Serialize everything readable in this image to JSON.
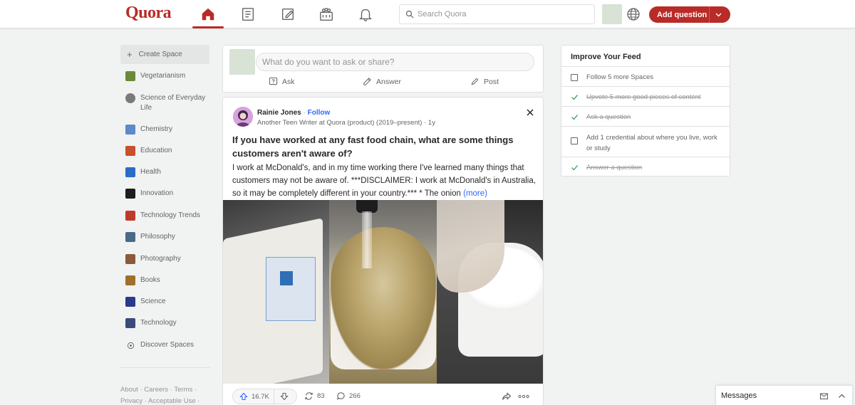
{
  "header": {
    "logo": "Quora",
    "search_placeholder": "Search Quora",
    "add_question_label": "Add question",
    "nav_icons": [
      "home-icon",
      "following-icon",
      "answer-icon",
      "spaces-icon",
      "notifications-icon"
    ],
    "brand_color": "#b92b27"
  },
  "sidebar": {
    "create_space": "Create Space",
    "items": [
      {
        "label": "Vegetarianism",
        "color": "#6a8a3a"
      },
      {
        "label": "Science of Everyday Life",
        "color": "#7a7a7a"
      },
      {
        "label": "Chemistry",
        "color": "#5b8bc9"
      },
      {
        "label": "Education",
        "color": "#c8502a"
      },
      {
        "label": "Health",
        "color": "#2a6cc8"
      },
      {
        "label": "Innovation",
        "color": "#1d1d1d"
      },
      {
        "label": "Technology Trends",
        "color": "#c03a2b"
      },
      {
        "label": "Philosophy",
        "color": "#4a6a8a"
      },
      {
        "label": "Photography",
        "color": "#8a5a3a"
      },
      {
        "label": "Books",
        "color": "#a0702a"
      },
      {
        "label": "Science",
        "color": "#2a3a8a"
      },
      {
        "label": "Technology",
        "color": "#3a4a7a"
      }
    ],
    "discover": "Discover Spaces",
    "footer_line1": "About · Careers · Terms ·",
    "footer_line2": "Privacy · Acceptable Use ·"
  },
  "ask_box": {
    "placeholder": "What do you want to ask or share?",
    "actions": [
      "Ask",
      "Answer",
      "Post"
    ]
  },
  "post": {
    "author": "Rainie Jones",
    "follow": "Follow",
    "separator": "·",
    "credential": "Another Teen Writer at Quora (product) (2019–present) · 1y",
    "title": "If you have worked at any fast food chain, what are some things customers aren't aware of?",
    "body": "I work at McDonald's, and in my time working there I've learned many things that customers may not be aware of. ***DISCLAIMER: I work at McDonald's in Australia, so it may be completely different in your country.*** * The onion",
    "more": "(more)",
    "upvotes": "16.7K",
    "shares": "83",
    "comments": "266"
  },
  "feed_card": {
    "title": "Improve Your Feed",
    "items": [
      {
        "label": "Follow 5 more Spaces",
        "done": false
      },
      {
        "label": "Upvote 5 more good pieces of content",
        "done": true
      },
      {
        "label": "Ask a question",
        "done": true
      },
      {
        "label": "Add 1 credential about where you live, work or study",
        "done": false
      },
      {
        "label": "Answer a question",
        "done": true
      }
    ]
  },
  "messages": {
    "label": "Messages"
  }
}
